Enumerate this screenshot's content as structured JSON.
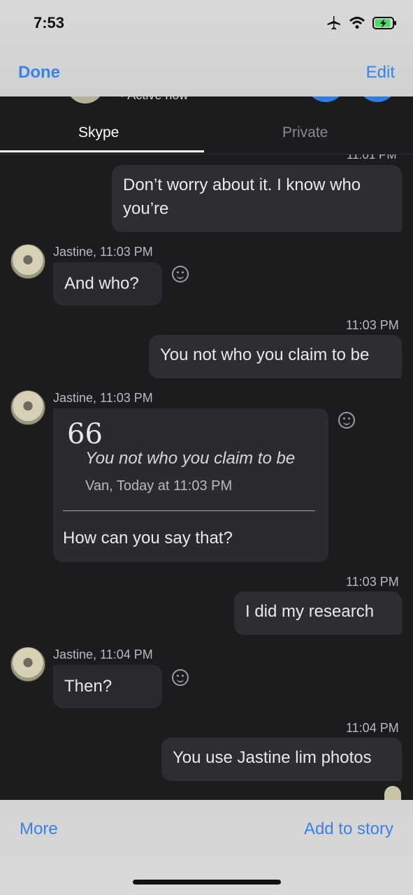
{
  "status_bar": {
    "time": "7:53"
  },
  "top_bar": {
    "done_label": "Done",
    "edit_label": "Edit"
  },
  "peek": {
    "status_text": "• Active now"
  },
  "tabs": [
    {
      "label": "Skype",
      "selected": true
    },
    {
      "label": "Private",
      "selected": false
    }
  ],
  "messages": {
    "cut_timestamp": "11:01 PM",
    "m1": {
      "text_line1": "Don’t worry about it. I know who",
      "text_line2": "you’re"
    },
    "m2": {
      "sender": "Jastine, 11:03 PM",
      "text": "And who?"
    },
    "m3": {
      "timestamp": "11:03 PM",
      "text": "You not who you claim to be"
    },
    "m4": {
      "sender": "Jastine, 11:03 PM",
      "quote_mark": "66",
      "quoted_text": "You not who you claim to be",
      "quoted_meta": "Van, Today at 11:03 PM",
      "reply": "How can you say that?"
    },
    "m5": {
      "timestamp": "11:03 PM",
      "text": "I did my research"
    },
    "m6": {
      "sender": "Jastine, 11:04 PM",
      "text": "Then?"
    },
    "m7": {
      "timestamp": "11:04 PM",
      "text": "You use Jastine lim photos"
    }
  },
  "bottom_bar": {
    "more_label": "More",
    "add_story_label": "Add to story"
  },
  "colors": {
    "accent": "#3a82e4",
    "background": "#1c1c1f",
    "bubble": "#2c2e34"
  },
  "icons": [
    "airplane-icon",
    "wifi-icon",
    "battery-charging-icon",
    "smiley-reaction-icon"
  ]
}
